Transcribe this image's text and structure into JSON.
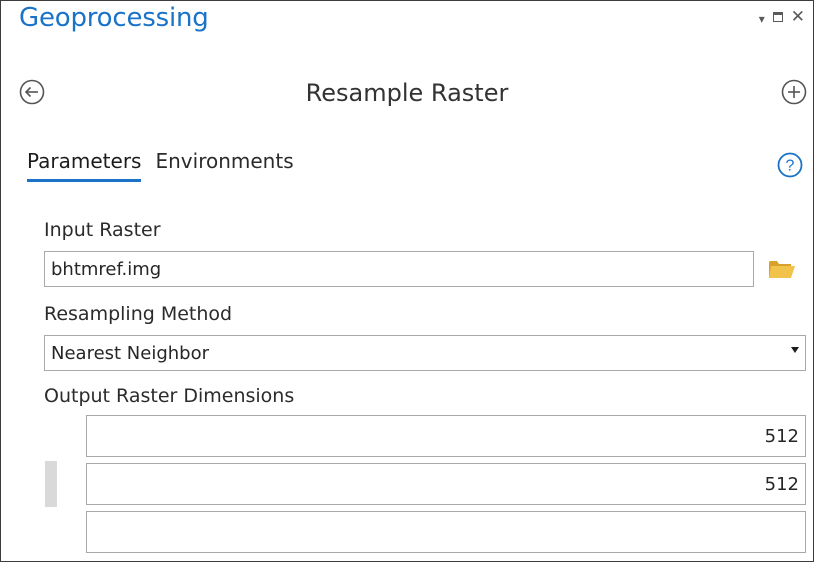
{
  "header": {
    "title": "Geoprocessing",
    "controls": {
      "dropdown_glyph": "▾",
      "close_glyph": "✕"
    }
  },
  "tool": {
    "title": "Resample Raster",
    "back_icon": "circle-arrow-left-icon",
    "add_icon": "circle-plus-icon"
  },
  "tabs": [
    {
      "label": "Parameters",
      "active": true
    },
    {
      "label": "Environments",
      "active": false
    }
  ],
  "help_icon": "help-circle-icon",
  "fields": {
    "input_raster": {
      "label": "Input Raster",
      "value": "bhtmref.img",
      "browse_icon": "folder-icon"
    },
    "resampling_method": {
      "label": "Resampling Method",
      "value": "Nearest Neighbor"
    },
    "output_dimensions": {
      "label": "Output Raster Dimensions",
      "values": [
        "512",
        "512",
        ""
      ]
    }
  },
  "colors": {
    "accent": "#1a73c8",
    "folder": "#e8b63a",
    "border": "#a9a9a9",
    "text": "#262626"
  }
}
